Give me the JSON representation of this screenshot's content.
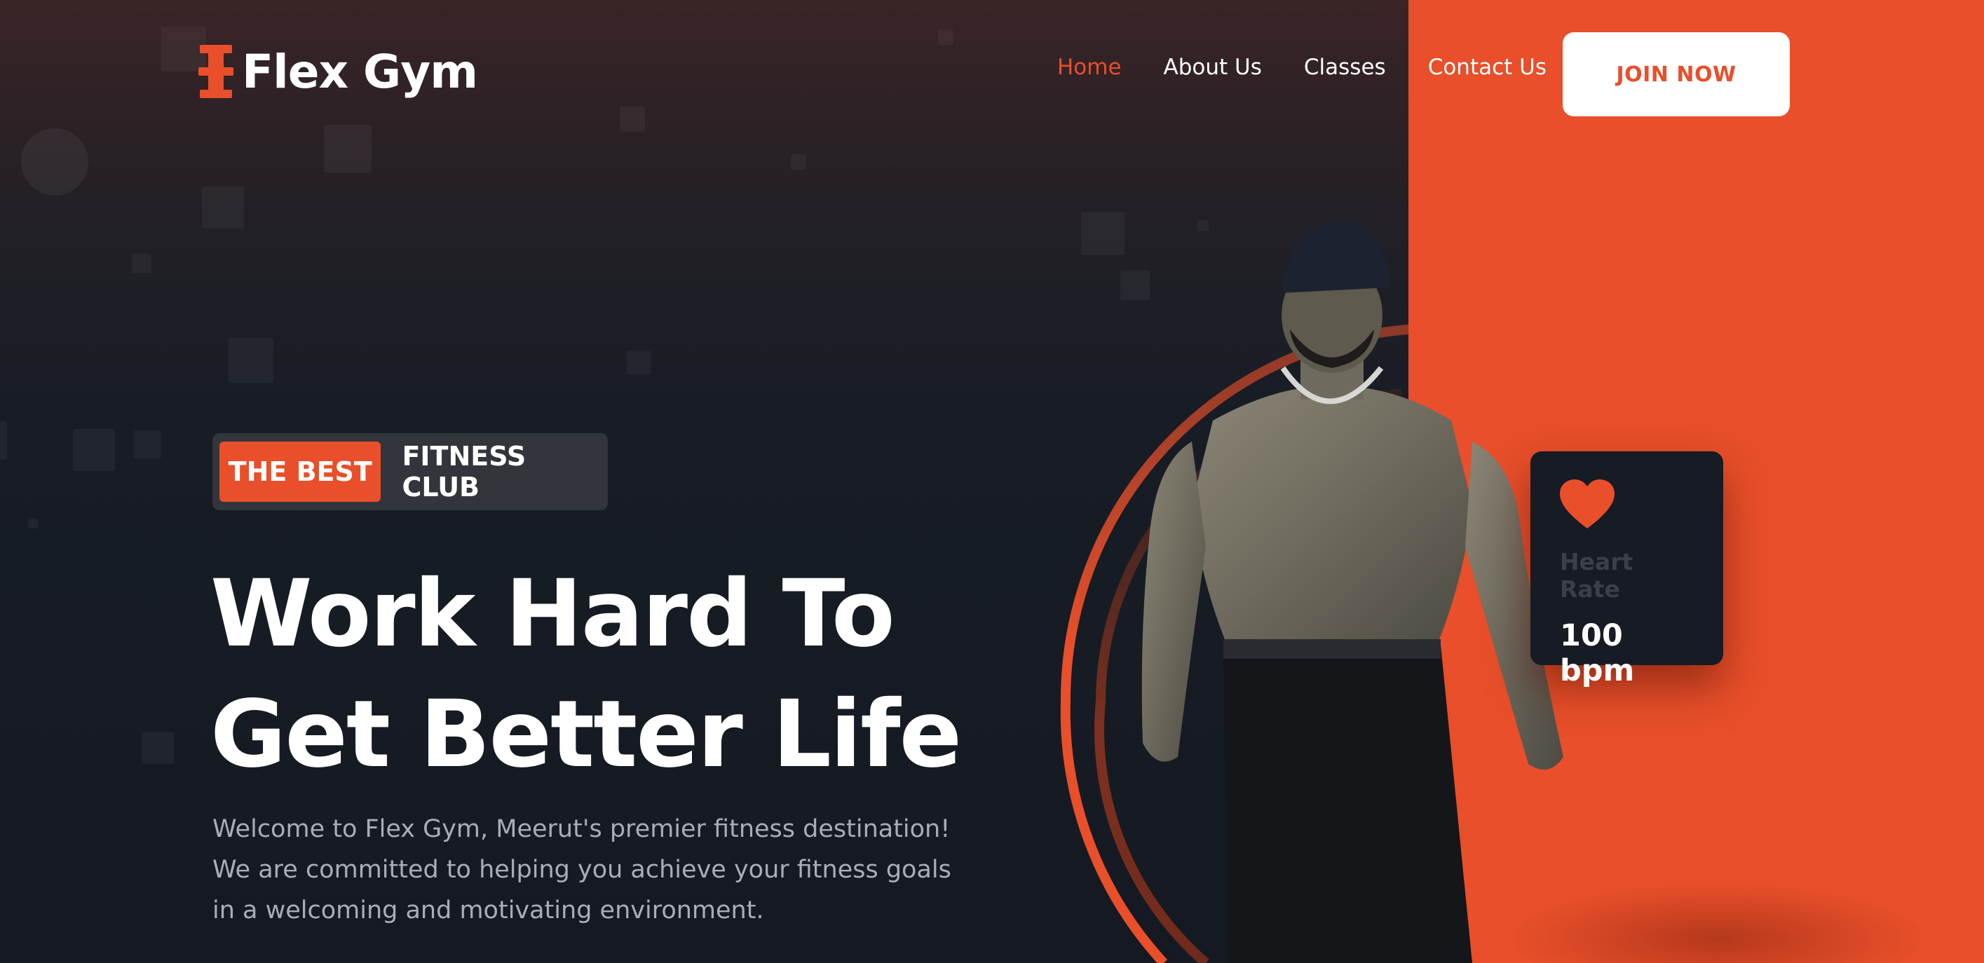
{
  "brand": {
    "name": "Flex Gym",
    "logo_icon": "dumbbell-icon"
  },
  "nav": {
    "items": [
      {
        "label": "Home",
        "active": true
      },
      {
        "label": "About Us",
        "active": false
      },
      {
        "label": "Classes",
        "active": false
      },
      {
        "label": "Contact Us",
        "active": false
      }
    ],
    "cta_label": "JOIN NOW"
  },
  "hero": {
    "badge_accent": "THE BEST",
    "badge_rest": "FITNESS CLUB",
    "headline_line1": "Work Hard To",
    "headline_line2": "Get Better Life",
    "description": "Welcome to Flex Gym, Meerut's premier fitness destination! We are committed to helping you achieve your fitness goals in a welcoming and motivating environment."
  },
  "heart_card": {
    "icon": "heart-icon",
    "label": "Heart Rate",
    "value": "100 bpm"
  },
  "colors": {
    "accent": "#e84f2a",
    "background": "#161b24",
    "text": "#ffffff",
    "muted_text": "#a9adb8"
  }
}
